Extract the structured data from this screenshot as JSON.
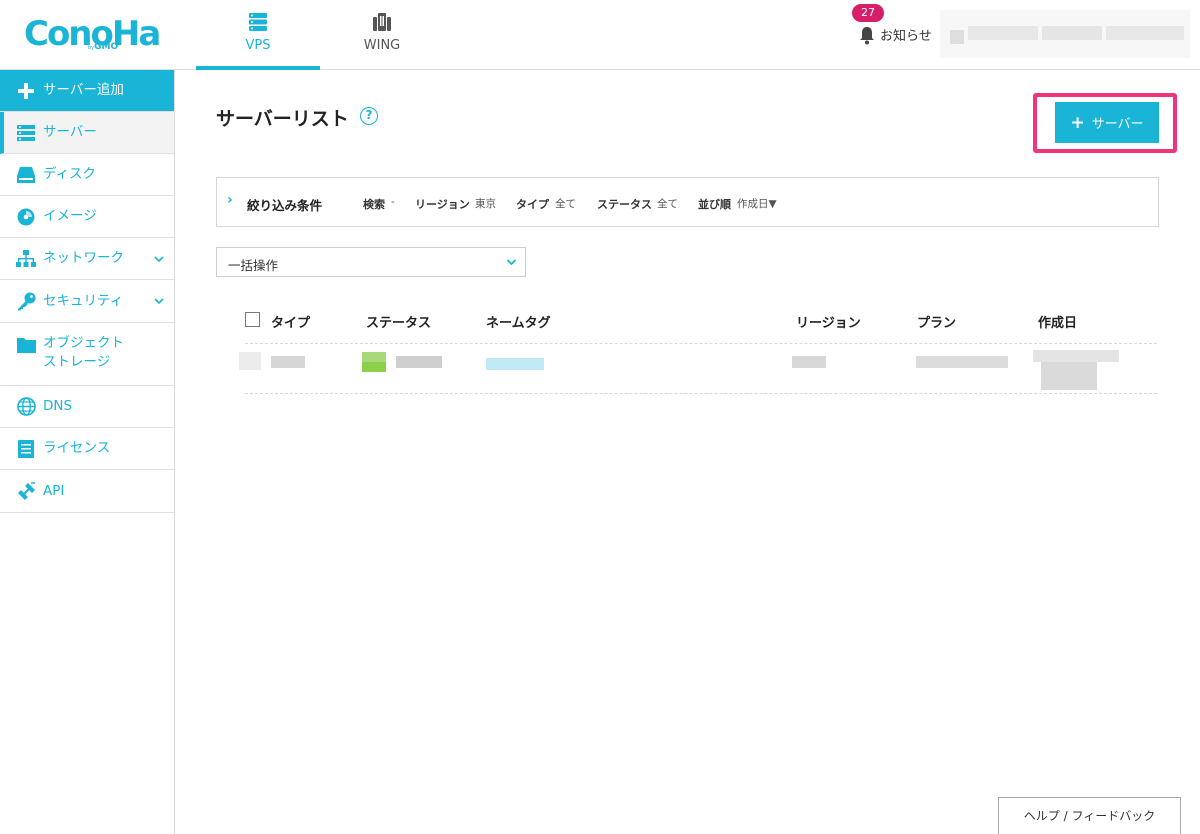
{
  "header": {
    "logo": {
      "text": "ConoHa",
      "sub_prefix": "by",
      "sub": "GMO"
    },
    "tabs": [
      {
        "label": "VPS",
        "icon": "server-stack-icon",
        "active": true
      },
      {
        "label": "WING",
        "icon": "building-icon",
        "active": false
      }
    ],
    "notice": {
      "count": "27",
      "label": "お知らせ"
    }
  },
  "sidebar": {
    "items": [
      {
        "label": "サーバー追加",
        "icon": "plus-icon"
      },
      {
        "label": "サーバー",
        "icon": "server-icon"
      },
      {
        "label": "ディスク",
        "icon": "disk-icon"
      },
      {
        "label": "イメージ",
        "icon": "image-icon"
      },
      {
        "label": "ネットワーク",
        "icon": "network-icon"
      },
      {
        "label": "セキュリティ",
        "icon": "key-icon"
      },
      {
        "label_line1": "オブジェクト",
        "label_line2": "ストレージ",
        "icon": "folder-icon"
      },
      {
        "label": "DNS",
        "icon": "globe-icon"
      },
      {
        "label": "ライセンス",
        "icon": "license-icon"
      },
      {
        "label": "API",
        "icon": "api-icon"
      }
    ]
  },
  "main": {
    "title": "サーバーリスト",
    "help_glyph": "?",
    "add_button": {
      "plus": "+",
      "label": "サーバー"
    },
    "filter": {
      "title": "絞り込み条件",
      "fields": [
        {
          "key": "検索",
          "value": "-"
        },
        {
          "key": "リージョン",
          "value": "東京"
        },
        {
          "key": "タイプ",
          "value": "全て"
        },
        {
          "key": "ステータス",
          "value": "全て"
        },
        {
          "key": "並び順",
          "value": "作成日▼"
        }
      ]
    },
    "bulk_select": {
      "value": "一括操作"
    },
    "table": {
      "columns": [
        "タイプ",
        "ステータス",
        "ネームタグ",
        "リージョン",
        "プラン",
        "作成日"
      ]
    }
  },
  "footer": {
    "help_label": "ヘルプ / フィードバック"
  },
  "colors": {
    "accent": "#1ab4d7",
    "highlight": "#f0357a",
    "badge": "#d61e6a"
  }
}
